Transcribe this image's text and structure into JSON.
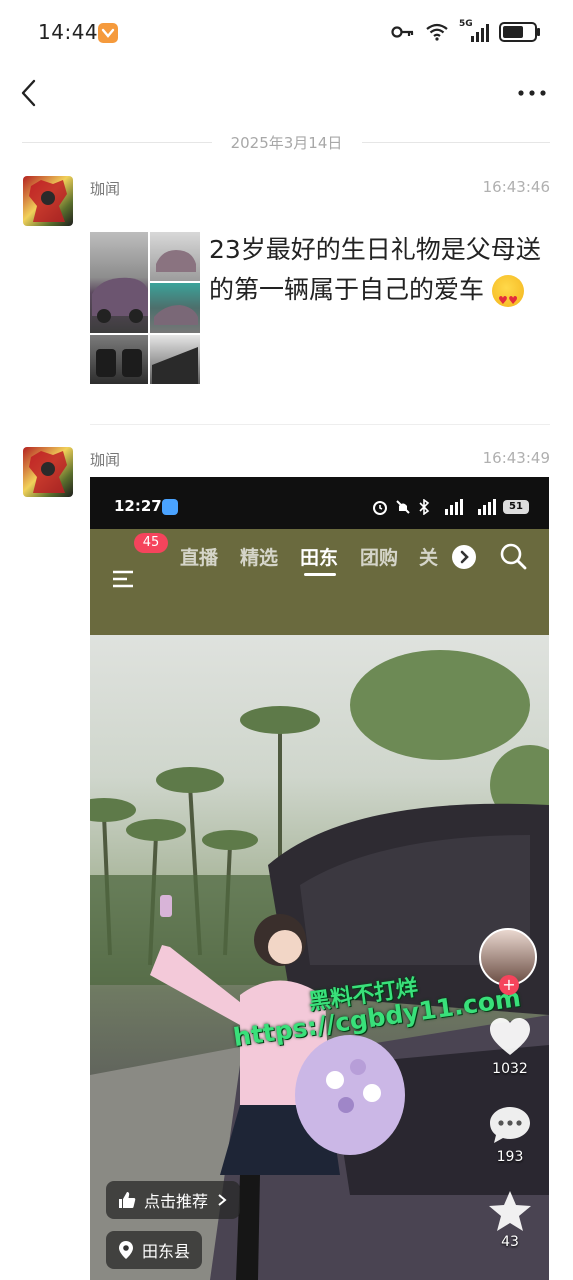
{
  "status_bar": {
    "time": "14:44",
    "network": "5G"
  },
  "date_divider": "2025年3月14日",
  "posts": [
    {
      "author": "珈闻",
      "time": "16:43:46",
      "text": "23岁最好的生日礼物是父母送的第一辆属于自己的爱车"
    },
    {
      "author": "珈闻",
      "time": "16:43:49"
    }
  ],
  "embedded": {
    "status_time": "12:27",
    "battery": "51",
    "badge_count": "45",
    "tabs": [
      "直播",
      "精选",
      "田东",
      "团购",
      "关"
    ],
    "active_tab": "田东",
    "watermark_line1": "黑料不打烊",
    "watermark_line2": "https://cgbdy11.com",
    "recommend_label": "点击推荐",
    "location_label": "田东县",
    "like_count": "1032",
    "comment_count": "193",
    "favorite_count": "43"
  },
  "colors": {
    "accent_badge": "#f5445c",
    "nav_bg": "#6a6a3e",
    "watermark": "#39e07a"
  }
}
